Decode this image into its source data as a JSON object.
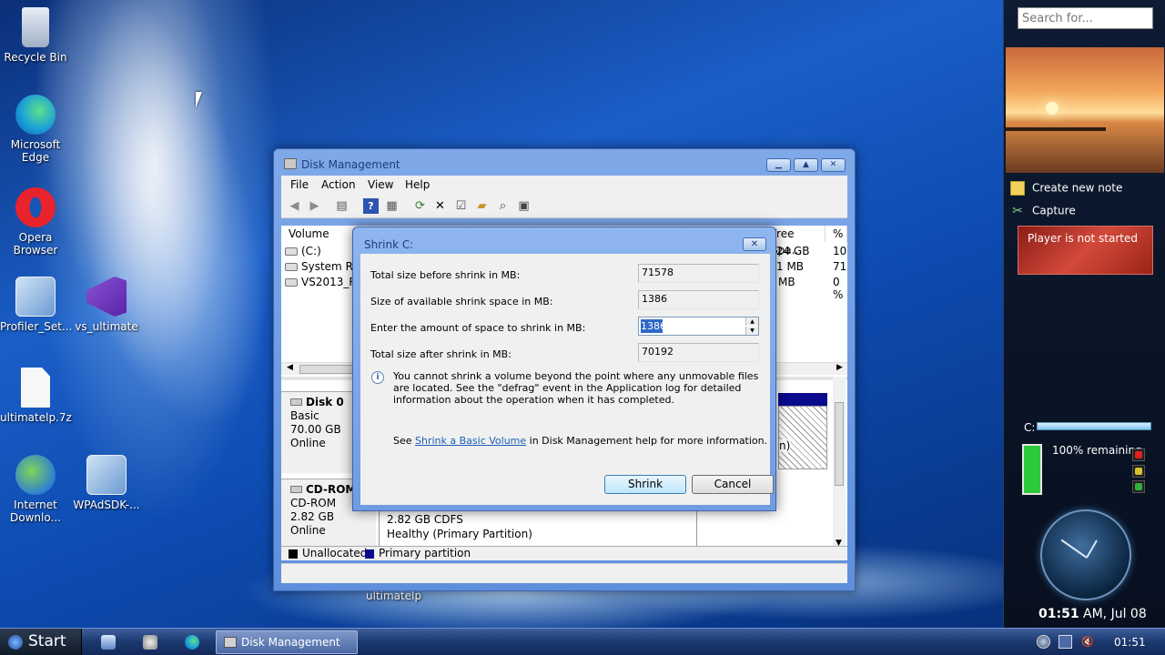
{
  "desktop": {
    "icons": [
      {
        "label": "Recycle Bin"
      },
      {
        "label": "Microsoft Edge"
      },
      {
        "label": "Opera Browser"
      },
      {
        "label": "Profiler_Set..."
      },
      {
        "label": "vs_ultimate"
      },
      {
        "label": "ultimatelp.7z"
      },
      {
        "label": "Internet Downlo..."
      },
      {
        "label": "WPAdSDK-..."
      }
    ],
    "behind_window_label": "ultimatelp"
  },
  "disk_management": {
    "title": "Disk Management",
    "menu": [
      "File",
      "Action",
      "View",
      "Help"
    ],
    "columns": [
      "Volume",
      "Free Spa...",
      "%"
    ],
    "volumes": [
      {
        "name": "(C:)",
        "free": ".24 GB",
        "pct": "10"
      },
      {
        "name": "System Re",
        "free": "1 MB",
        "pct": "71"
      },
      {
        "name": "VS2013_RT",
        "free": "MB",
        "pct": "0 %"
      }
    ],
    "disks": [
      {
        "name": "Disk 0",
        "type": "Basic",
        "size": "70.00 GB",
        "status": "Online",
        "partition_note": "n)"
      },
      {
        "name": "CD-ROM",
        "type": "CD-ROM",
        "size": "2.82 GB",
        "status": "Online",
        "partition_size": "2.82 GB CDFS",
        "partition_health": "Healthy (Primary Partition)"
      }
    ],
    "legend": [
      {
        "label": "Unallocated",
        "color": "#000000"
      },
      {
        "label": "Primary partition",
        "color": "#0a0a8c"
      }
    ]
  },
  "shrink_dialog": {
    "title": "Shrink C:",
    "close_label": "✕",
    "fields": {
      "total_before_label": "Total size before shrink in MB:",
      "total_before_value": "71578",
      "available_label": "Size of available shrink space in MB:",
      "available_value": "1386",
      "amount_label": "Enter the amount of space to shrink in MB:",
      "amount_value": "1386",
      "total_after_label": "Total size after shrink in MB:",
      "total_after_value": "70192"
    },
    "info_text": "You cannot shrink a volume beyond the point where any unmovable files are located. See the \"defrag\" event in the Application log for detailed information about the operation when it has completed.",
    "help_prefix": "See ",
    "help_link": "Shrink a Basic Volume",
    "help_suffix": " in Disk Management help for more information.",
    "shrink_button": "Shrink",
    "cancel_button": "Cancel"
  },
  "sidebar": {
    "search_placeholder": "Search for...",
    "create_note": "Create new note",
    "capture": "Capture",
    "player_status": "Player is not started",
    "drive_label": "C:",
    "battery_text": "100% remaining",
    "time_bold": "01:51",
    "time_rest": " AM, Jul 08"
  },
  "taskbar": {
    "start_label": "Start",
    "task_label": "Disk Management",
    "clock": "01:51"
  },
  "colors": {
    "accent": "#3168c8",
    "link": "#1b5fb5"
  }
}
